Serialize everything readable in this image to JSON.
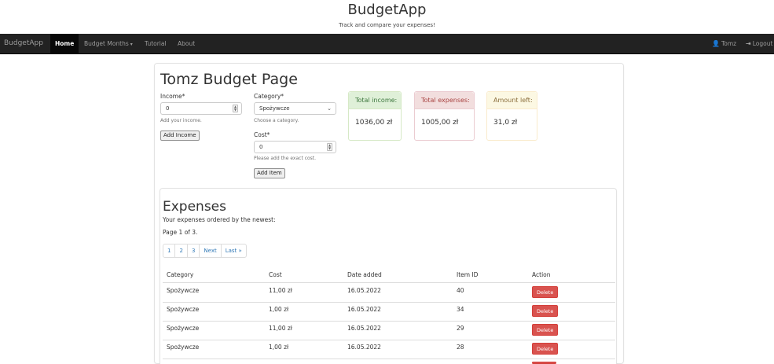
{
  "header": {
    "title": "BudgetApp",
    "tagline": "Track and compare your expenses!"
  },
  "navbar": {
    "brand": "BudgetApp",
    "items": [
      "Home",
      "Budget Months",
      "Tutorial",
      "About"
    ],
    "user": "Tomz",
    "logout": "Logout"
  },
  "page": {
    "title": "Tomz Budget Page"
  },
  "income_form": {
    "label": "Income*",
    "value": "0",
    "help": "Add your income.",
    "button": "Add Income"
  },
  "item_form": {
    "category_label": "Category*",
    "category_selected": "Spożywcze",
    "category_help": "Choose a category.",
    "cost_label": "Cost*",
    "cost_value": "0",
    "cost_help": "Please add the exact cost.",
    "button": "Add Item"
  },
  "summary": {
    "income": {
      "label": "Total income:",
      "value": "1036,00 zł"
    },
    "expenses": {
      "label": "Total expenses:",
      "value": "1005,00 zł"
    },
    "left": {
      "label": "Amount left:",
      "value": "31,0 zł"
    }
  },
  "expenses": {
    "title": "Expenses",
    "subtitle": "Your expenses ordered by the newest:",
    "page_info": "Page 1 of 3.",
    "pagination": [
      "1",
      "2",
      "3",
      "Next",
      "Last »"
    ],
    "columns": [
      "Category",
      "Cost",
      "Date added",
      "Item ID",
      "Action"
    ],
    "rows": [
      {
        "category": "Spożywcze",
        "cost": "11,00 zł",
        "date": "16.05.2022",
        "id": "40",
        "action": "Delete"
      },
      {
        "category": "Spożywcze",
        "cost": "1,00 zł",
        "date": "16.05.2022",
        "id": "34",
        "action": "Delete"
      },
      {
        "category": "Spożywcze",
        "cost": "11,00 zł",
        "date": "16.05.2022",
        "id": "29",
        "action": "Delete"
      },
      {
        "category": "Spożywcze",
        "cost": "1,00 zł",
        "date": "16.05.2022",
        "id": "28",
        "action": "Delete"
      }
    ]
  },
  "colors": {
    "navbar": "#222222",
    "link": "#337ab7",
    "danger": "#d9534f",
    "success_bg": "#dff0d8",
    "danger_bg": "#f2dede",
    "warning_bg": "#fcf8e3"
  }
}
